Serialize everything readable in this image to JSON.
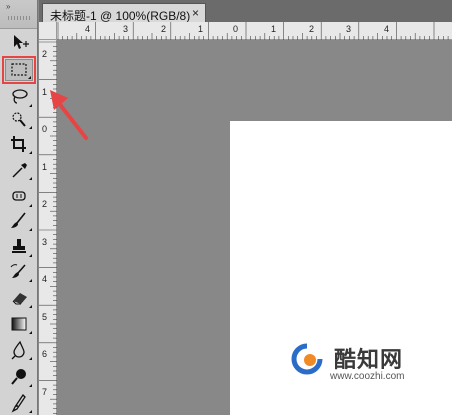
{
  "document": {
    "tab_title": "未标题-1 @ 100%(RGB/8)",
    "close_glyph": "×"
  },
  "toolbox": {
    "collapse_glyph": "»",
    "tools": [
      {
        "name": "move-tool",
        "icon": "move-icon",
        "selected": false
      },
      {
        "name": "rectangular-marquee-tool",
        "icon": "marquee-icon",
        "selected": true
      },
      {
        "name": "lasso-tool",
        "icon": "lasso-icon",
        "selected": false
      },
      {
        "name": "quick-selection-tool",
        "icon": "quick-selection-icon",
        "selected": false
      },
      {
        "name": "crop-tool",
        "icon": "crop-icon",
        "selected": false
      },
      {
        "name": "eyedropper-tool",
        "icon": "eyedropper-icon",
        "selected": false
      },
      {
        "name": "spot-healing-tool",
        "icon": "healing-icon",
        "selected": false
      },
      {
        "name": "brush-tool",
        "icon": "brush-icon",
        "selected": false
      },
      {
        "name": "clone-stamp-tool",
        "icon": "stamp-icon",
        "selected": false
      },
      {
        "name": "history-brush-tool",
        "icon": "history-brush-icon",
        "selected": false
      },
      {
        "name": "eraser-tool",
        "icon": "eraser-icon",
        "selected": false
      },
      {
        "name": "gradient-tool",
        "icon": "gradient-icon",
        "selected": false
      },
      {
        "name": "blur-tool",
        "icon": "blur-icon",
        "selected": false
      },
      {
        "name": "dodge-tool",
        "icon": "dodge-icon",
        "selected": false
      },
      {
        "name": "pen-tool",
        "icon": "pen-icon",
        "selected": false
      }
    ]
  },
  "rulers": {
    "top_labels": [
      "4",
      "3",
      "2",
      "1",
      "0",
      "1",
      "2",
      "3",
      "4"
    ],
    "left_labels": [
      "2",
      "1",
      "0",
      "1",
      "2",
      "3",
      "4",
      "5",
      "6",
      "7"
    ]
  },
  "watermark": {
    "name": "酷知网",
    "url": "www.coozhi.com"
  },
  "colors": {
    "highlight": "#e64545",
    "workspace": "#888888",
    "document": "#ffffff"
  }
}
